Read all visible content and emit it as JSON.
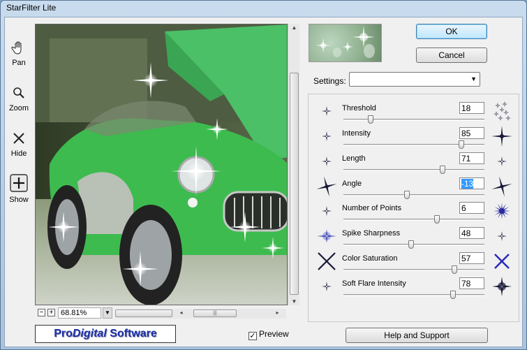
{
  "window": {
    "title": "StarFilter Lite"
  },
  "tools": [
    {
      "name": "pan",
      "label": "Pan",
      "icon": "hand-icon"
    },
    {
      "name": "zoom",
      "label": "Zoom",
      "icon": "magnifier-icon"
    },
    {
      "name": "hide",
      "label": "Hide",
      "icon": "x-cross-icon"
    },
    {
      "name": "show",
      "label": "Show",
      "icon": "plus-box-icon"
    }
  ],
  "zoom": {
    "value": "68.81%",
    "minus": "−",
    "plus": "+"
  },
  "logo": {
    "pro": "Pro",
    "digital": "Digital",
    "software": " Software"
  },
  "preview_checkbox": {
    "label": "Preview",
    "checked": true
  },
  "buttons": {
    "ok": "OK",
    "cancel": "Cancel",
    "help": "Help and Support"
  },
  "settings": {
    "label": "Settings:",
    "value": ""
  },
  "params": [
    {
      "label": "Threshold",
      "value": "18",
      "fraction": 0.18
    },
    {
      "label": "Intensity",
      "value": "85",
      "fraction": 0.85
    },
    {
      "label": "Length",
      "value": "71",
      "fraction": 0.71
    },
    {
      "label": "Angle",
      "value": "-13",
      "fraction": 0.45,
      "selected": true
    },
    {
      "label": "Number of Points",
      "value": "6",
      "fraction": 0.67
    },
    {
      "label": "Spike Sharpness",
      "value": "48",
      "fraction": 0.48
    },
    {
      "label": "Color Saturation",
      "value": "57",
      "fraction": 0.8
    },
    {
      "label": "Soft Flare Intensity",
      "value": "78",
      "fraction": 0.79
    }
  ],
  "colors": {
    "car_green": "#3dbb4f",
    "brand_blue": "#1a2ea8",
    "selection": "#3399ff"
  }
}
